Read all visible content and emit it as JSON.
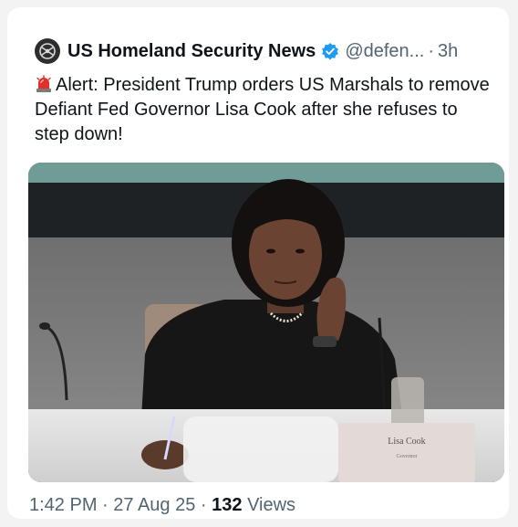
{
  "tweet": {
    "account_name": "US Homeland Security News",
    "handle": "@defen...",
    "separator": "·",
    "time_ago": "3h",
    "alert_icon": "police-siren-icon",
    "text": "Alert: President Trump orders US Marshals to remove Defiant Fed Governor Lisa Cook after she refuses to step down!",
    "photo": {
      "nameplate_line1": "Lisa Cook",
      "nameplate_line2": "Governor"
    },
    "timestamp": "1:42 PM · 27 Aug 25 ·",
    "views_count": "132",
    "views_label": "Views"
  },
  "colors": {
    "verified_badge": "#1d9bf0",
    "text_primary": "#0f1419",
    "text_secondary": "#536471"
  }
}
